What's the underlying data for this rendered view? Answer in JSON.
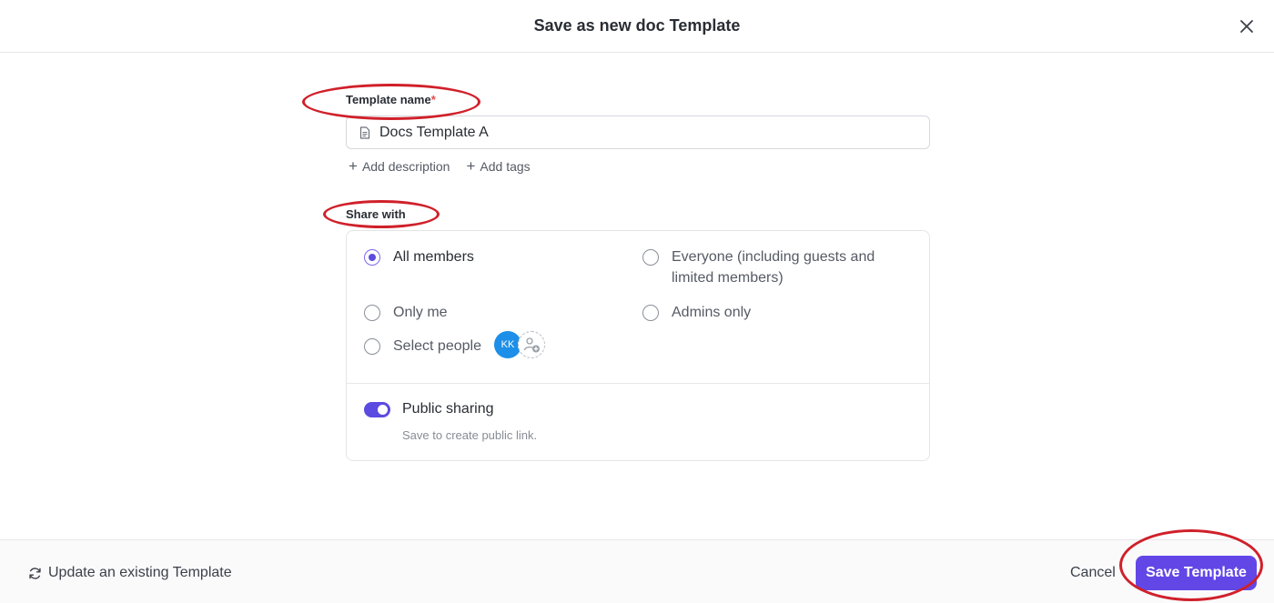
{
  "header": {
    "title": "Save as new doc Template"
  },
  "template_name": {
    "label": "Template name",
    "required_mark": "*",
    "value": "Docs Template A"
  },
  "add_links": {
    "description": "Add description",
    "tags": "Add tags",
    "plus": "+"
  },
  "share_with": {
    "label": "Share with",
    "options": {
      "all_members": "All members",
      "everyone": "Everyone (including guests and limited members)",
      "only_me": "Only me",
      "admins_only": "Admins only",
      "select_people": "Select people"
    },
    "selected": "all_members",
    "avatar_initials": "KK",
    "public_sharing": {
      "label": "Public sharing",
      "subtext": "Save to create public link.",
      "enabled": true
    }
  },
  "footer": {
    "update_existing": "Update an existing Template",
    "cancel": "Cancel",
    "save": "Save Template"
  },
  "colors": {
    "accent": "#6247e6",
    "annotation": "#d0202a",
    "avatar": "#1d8fe8"
  }
}
